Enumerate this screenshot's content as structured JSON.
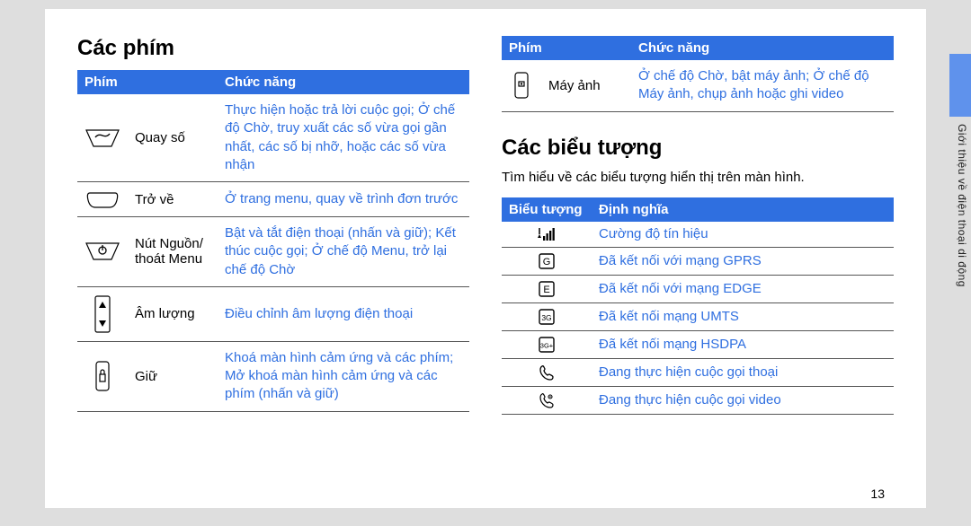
{
  "side_label": "Giới thiệu về điện thoại di động",
  "page_number": "13",
  "left": {
    "heading": "Các phím",
    "th_key": "Phím",
    "th_func": "Chức năng",
    "rows": [
      {
        "label": "Quay số",
        "func": "Thực hiện hoặc trả lời cuộc gọi; Ở chế độ Chờ, truy xuất các số vừa gọi gần nhất, các số bị nhỡ, hoặc các số vừa nhận"
      },
      {
        "label": "Trở về",
        "func": "Ở trang menu, quay về trình đơn trước"
      },
      {
        "label": "Nút Nguồn/ thoát Menu",
        "func": "Bật và tắt điện thoại (nhấn và giữ); Kết thúc cuộc gọi; Ở chế độ Menu, trở lại chế độ Chờ"
      },
      {
        "label": "Âm lượng",
        "func": "Điều chỉnh âm lượng điện thoại"
      },
      {
        "label": "Giữ",
        "func": "Khoá màn hình cảm ứng và các phím; Mở khoá màn hình cảm ứng và các phím (nhấn và giữ)"
      }
    ]
  },
  "right_keys": {
    "th_key": "Phím",
    "th_func": "Chức năng",
    "rows": [
      {
        "label": "Máy ảnh",
        "func": "Ở chế độ Chờ, bật máy ảnh; Ở chế độ Máy ảnh, chụp ảnh hoặc ghi video"
      }
    ]
  },
  "icons_section": {
    "heading": "Các biểu tượng",
    "desc": "Tìm hiểu về các biểu tượng hiển thị trên màn hình.",
    "th_icon": "Biểu tượng",
    "th_def": "Định nghĩa",
    "rows": [
      {
        "def": "Cường độ tín hiệu"
      },
      {
        "def": "Đã kết nối với mạng GPRS"
      },
      {
        "def": "Đã kết nối với mạng EDGE"
      },
      {
        "def": "Đã kết nối mạng UMTS"
      },
      {
        "def": "Đã kết nối mạng HSDPA"
      },
      {
        "def": "Đang thực hiện cuộc gọi thoại"
      },
      {
        "def": "Đang thực hiện cuộc gọi video"
      }
    ]
  }
}
